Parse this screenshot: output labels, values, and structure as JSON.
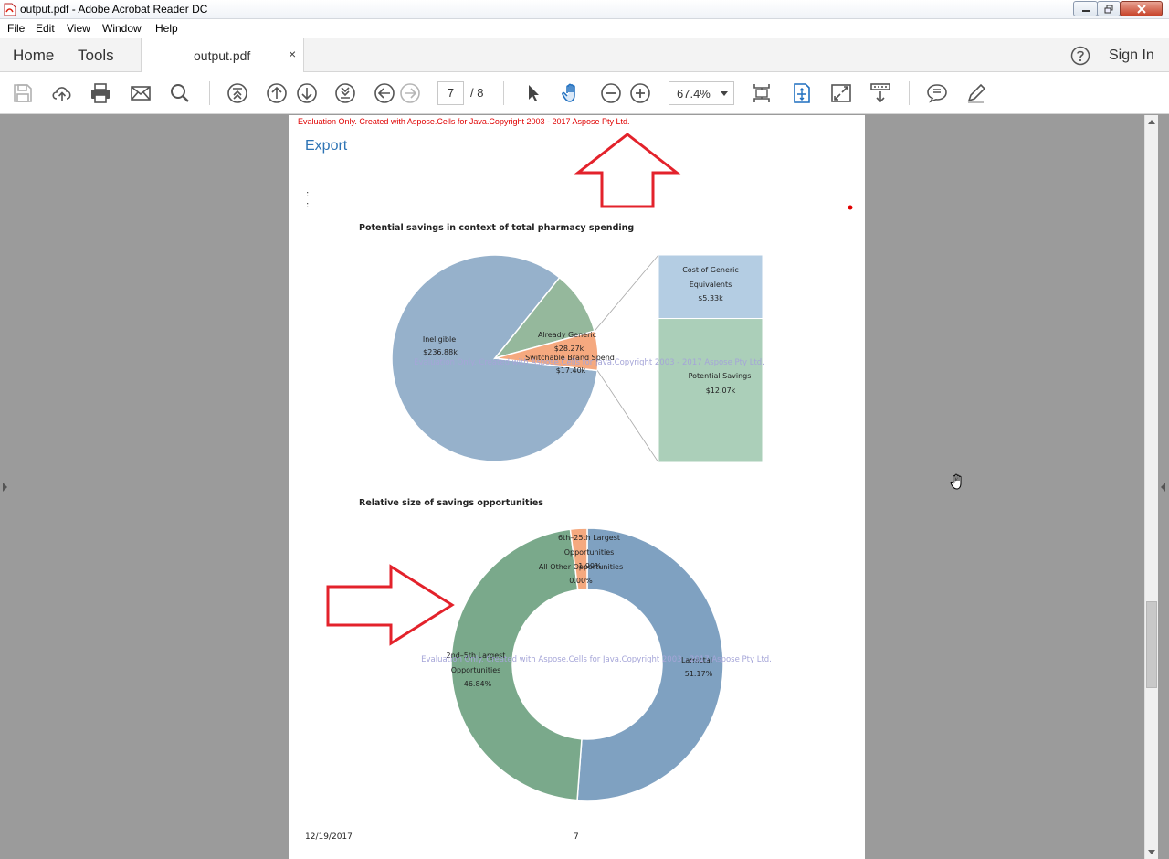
{
  "window": {
    "title": "output.pdf - Adobe Acrobat Reader DC"
  },
  "menu": [
    "File",
    "Edit",
    "View",
    "Window",
    "Help"
  ],
  "tabs": {
    "home": "Home",
    "tools": "Tools",
    "document": "output.pdf",
    "close_glyph": "×",
    "help_icon": "help-circle-icon",
    "sign_in": "Sign In"
  },
  "toolbar": {
    "icons": [
      "save-icon",
      "upload-cloud-icon",
      "print-icon",
      "email-icon",
      "search-icon",
      "first-page-icon",
      "prev-page-icon",
      "next-page-icon",
      "last-page-icon",
      "back-icon",
      "forward-icon",
      "select-cursor-icon",
      "hand-tool-icon",
      "zoom-out-icon",
      "zoom-in-icon",
      "fit-page-icon",
      "marquee-zoom-icon",
      "full-screen-icon",
      "read-mode-icon",
      "comment-icon",
      "highlight-pen-icon"
    ],
    "current_page": "7",
    "page_total": "/ 8",
    "zoom": "67.4%"
  },
  "document": {
    "eval_banner": "Evaluation Only. Created with Aspose.Cells for Java.Copyright 2003 - 2017 Aspose Pty Ltd.",
    "section_title": "Export",
    "footer_date": "12/19/2017",
    "footer_page": "7",
    "annotation_color": "#e3222b"
  },
  "chart_data": [
    {
      "type": "pie",
      "title": "Potential savings in context of total pharmacy spending",
      "watermark": "Evaluation Only. Created with Aspose.Cells for Java.Copyright 2003 - 2017 Aspose Pty Ltd.",
      "slices": [
        {
          "label": "Ineligible",
          "value_label": "$236.88k",
          "value": 236.88,
          "color": "#96b1cb"
        },
        {
          "label": "Already Generic",
          "value_label": "$28.27k",
          "value": 28.27,
          "color": "#95b89c"
        },
        {
          "label": "Switchable Brand Spend",
          "value_label": "$17.40k",
          "value": 17.4,
          "color": "#f5a97f"
        }
      ],
      "breakdown": {
        "type": "stacked-bar",
        "segments": [
          {
            "label_lines": [
              "Cost of Generic",
              "Equivalents"
            ],
            "value_label": "$5.33k",
            "value": 5.33,
            "color": "#b4cde3"
          },
          {
            "label_lines": [
              "Potential Savings"
            ],
            "value_label": "$12.07k",
            "value": 12.07,
            "color": "#abcfb9"
          }
        ]
      }
    },
    {
      "type": "doughnut",
      "title": "Relative size of savings opportunities",
      "watermark": "Evaluation Only. Created with Aspose.Cells for Java.Copyright 2003 - 2017 Aspose Pty Ltd.",
      "slices": [
        {
          "label_lines": [
            "Lamictal"
          ],
          "value_label": "51.17%",
          "value": 51.17,
          "color": "#7fa1c1"
        },
        {
          "label_lines": [
            "2nd–5th Largest",
            "Opportunities"
          ],
          "value_label": "46.84%",
          "value": 46.84,
          "color": "#7aa98b"
        },
        {
          "label_lines": [
            "6th–25th Largest",
            "Opportunities"
          ],
          "value_label": "1.99%",
          "value": 1.99,
          "color": "#f5a97f"
        },
        {
          "label_lines": [
            "All Other Opportunities"
          ],
          "value_label": "0.00%",
          "value": 0.0,
          "color": "#7fa1c1"
        }
      ]
    }
  ]
}
